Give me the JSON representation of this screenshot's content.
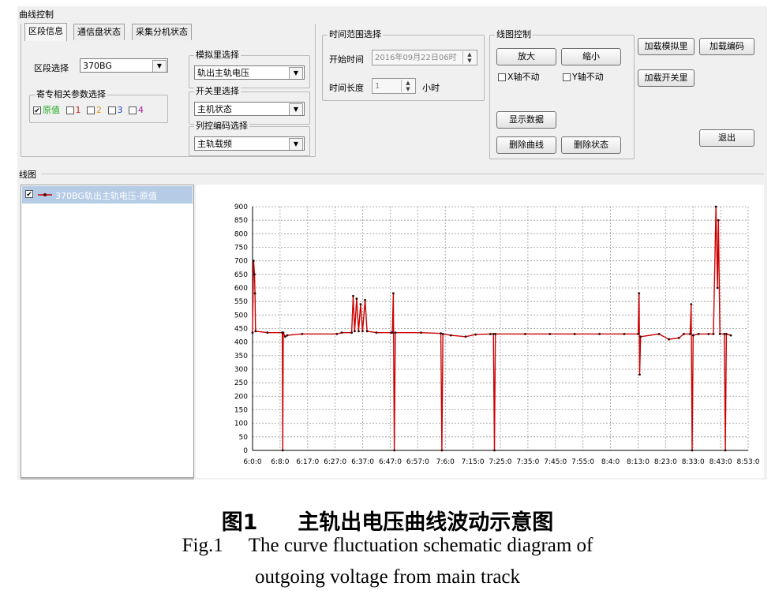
{
  "window": {
    "title": "曲线控制",
    "line_section_title": "线图"
  },
  "tabs": [
    "区段信息",
    "通信盘状态",
    "采集分机状态"
  ],
  "section_select": {
    "label": "区段选择",
    "value": "370BG"
  },
  "params_group": {
    "title": "寄专相关参数选择",
    "options": [
      {
        "label": "原值",
        "checked": true,
        "color": "#22aa22"
      },
      {
        "label": "1",
        "checked": false,
        "color": "#cc2222"
      },
      {
        "label": "2",
        "checked": false,
        "color": "#e09a20"
      },
      {
        "label": "3",
        "checked": false,
        "color": "#2244cc"
      },
      {
        "label": "4",
        "checked": false,
        "color": "#a020a0"
      }
    ]
  },
  "analog_group": {
    "title": "模拟里选择",
    "value": "轨出主轨电压"
  },
  "switch_group": {
    "title": "开关里选择",
    "value": "主机状态"
  },
  "code_group": {
    "title": "列控编码选择",
    "value": "主轨载频"
  },
  "time_group": {
    "title": "时间范围选择",
    "start_label": "开始时间",
    "start_value": "2016年09月22日06时",
    "length_label": "时间长度",
    "length_value": "1",
    "length_unit": "小时"
  },
  "chart_control": {
    "title": "线图控制",
    "zoom_in": "放大",
    "zoom_out": "缩小",
    "x_lock": "X轴不动",
    "y_lock": "Y轴不动",
    "show_data": "显示数据",
    "delete_curve": "删除曲线",
    "delete_state": "删除状态"
  },
  "right_buttons": {
    "load_analog": "加载模拟里",
    "load_code": "加载编码",
    "load_switch": "加载开关里",
    "exit": "退出"
  },
  "legend_item": {
    "label": "370BG轨出主轨电压-原值",
    "checked": true
  },
  "chart_data": {
    "type": "line",
    "xlabel": "",
    "ylabel": "",
    "ylim": [
      0,
      900
    ],
    "yticks": [
      0,
      50,
      100,
      150,
      200,
      250,
      300,
      350,
      400,
      450,
      500,
      550,
      600,
      650,
      700,
      750,
      800,
      850,
      900
    ],
    "xticks": [
      "6:0:0",
      "6:8:0",
      "6:17:0",
      "6:27:0",
      "6:37:0",
      "6:47:0",
      "6:57:0",
      "7:6:0",
      "7:15:0",
      "7:25:0",
      "7:35:0",
      "7:45:0",
      "7:55:0",
      "8:4:0",
      "8:13:0",
      "8:23:0",
      "8:33:0",
      "8:43:0",
      "8:53:0"
    ],
    "grid": true,
    "series": [
      {
        "color": "#cc0000",
        "points": [
          [
            0,
            435
          ],
          [
            0.2,
            700
          ],
          [
            0.4,
            650
          ],
          [
            0.5,
            580
          ],
          [
            0.6,
            440
          ],
          [
            3,
            435
          ],
          [
            6,
            435
          ],
          [
            6.1,
            0
          ],
          [
            6.2,
            435
          ],
          [
            6.6,
            420
          ],
          [
            7,
            425
          ],
          [
            10,
            430
          ],
          [
            17,
            430
          ],
          [
            18,
            435
          ],
          [
            20,
            435
          ],
          [
            20.3,
            570
          ],
          [
            20.6,
            440
          ],
          [
            21,
            560
          ],
          [
            21.4,
            440
          ],
          [
            21.8,
            540
          ],
          [
            22.2,
            440
          ],
          [
            22.7,
            555
          ],
          [
            23.1,
            440
          ],
          [
            25,
            435
          ],
          [
            28,
            435
          ],
          [
            28.2,
            435
          ],
          [
            28.4,
            580
          ],
          [
            28.6,
            0
          ],
          [
            28.8,
            435
          ],
          [
            34,
            435
          ],
          [
            38,
            432
          ],
          [
            38.2,
            0
          ],
          [
            38.4,
            430
          ],
          [
            40,
            425
          ],
          [
            43,
            420
          ],
          [
            45,
            428
          ],
          [
            48,
            430
          ],
          [
            48.6,
            430
          ],
          [
            48.8,
            0
          ],
          [
            49,
            430
          ],
          [
            55,
            430
          ],
          [
            60,
            430
          ],
          [
            65,
            430
          ],
          [
            70,
            430
          ],
          [
            75,
            430
          ],
          [
            77.8,
            430
          ],
          [
            78,
            580
          ],
          [
            78.1,
            280
          ],
          [
            78.3,
            420
          ],
          [
            82,
            430
          ],
          [
            84,
            410
          ],
          [
            86,
            415
          ],
          [
            87,
            430
          ],
          [
            88.3,
            430
          ],
          [
            88.5,
            540
          ],
          [
            88.7,
            0
          ],
          [
            88.9,
            425
          ],
          [
            90,
            430
          ],
          [
            92,
            430
          ],
          [
            93,
            430
          ],
          [
            93.5,
            900
          ],
          [
            93.8,
            600
          ],
          [
            94,
            850
          ],
          [
            94.3,
            430
          ],
          [
            95.2,
            430
          ],
          [
            95.4,
            0
          ],
          [
            95.6,
            430
          ],
          [
            96.5,
            425
          ]
        ]
      }
    ]
  }
}
